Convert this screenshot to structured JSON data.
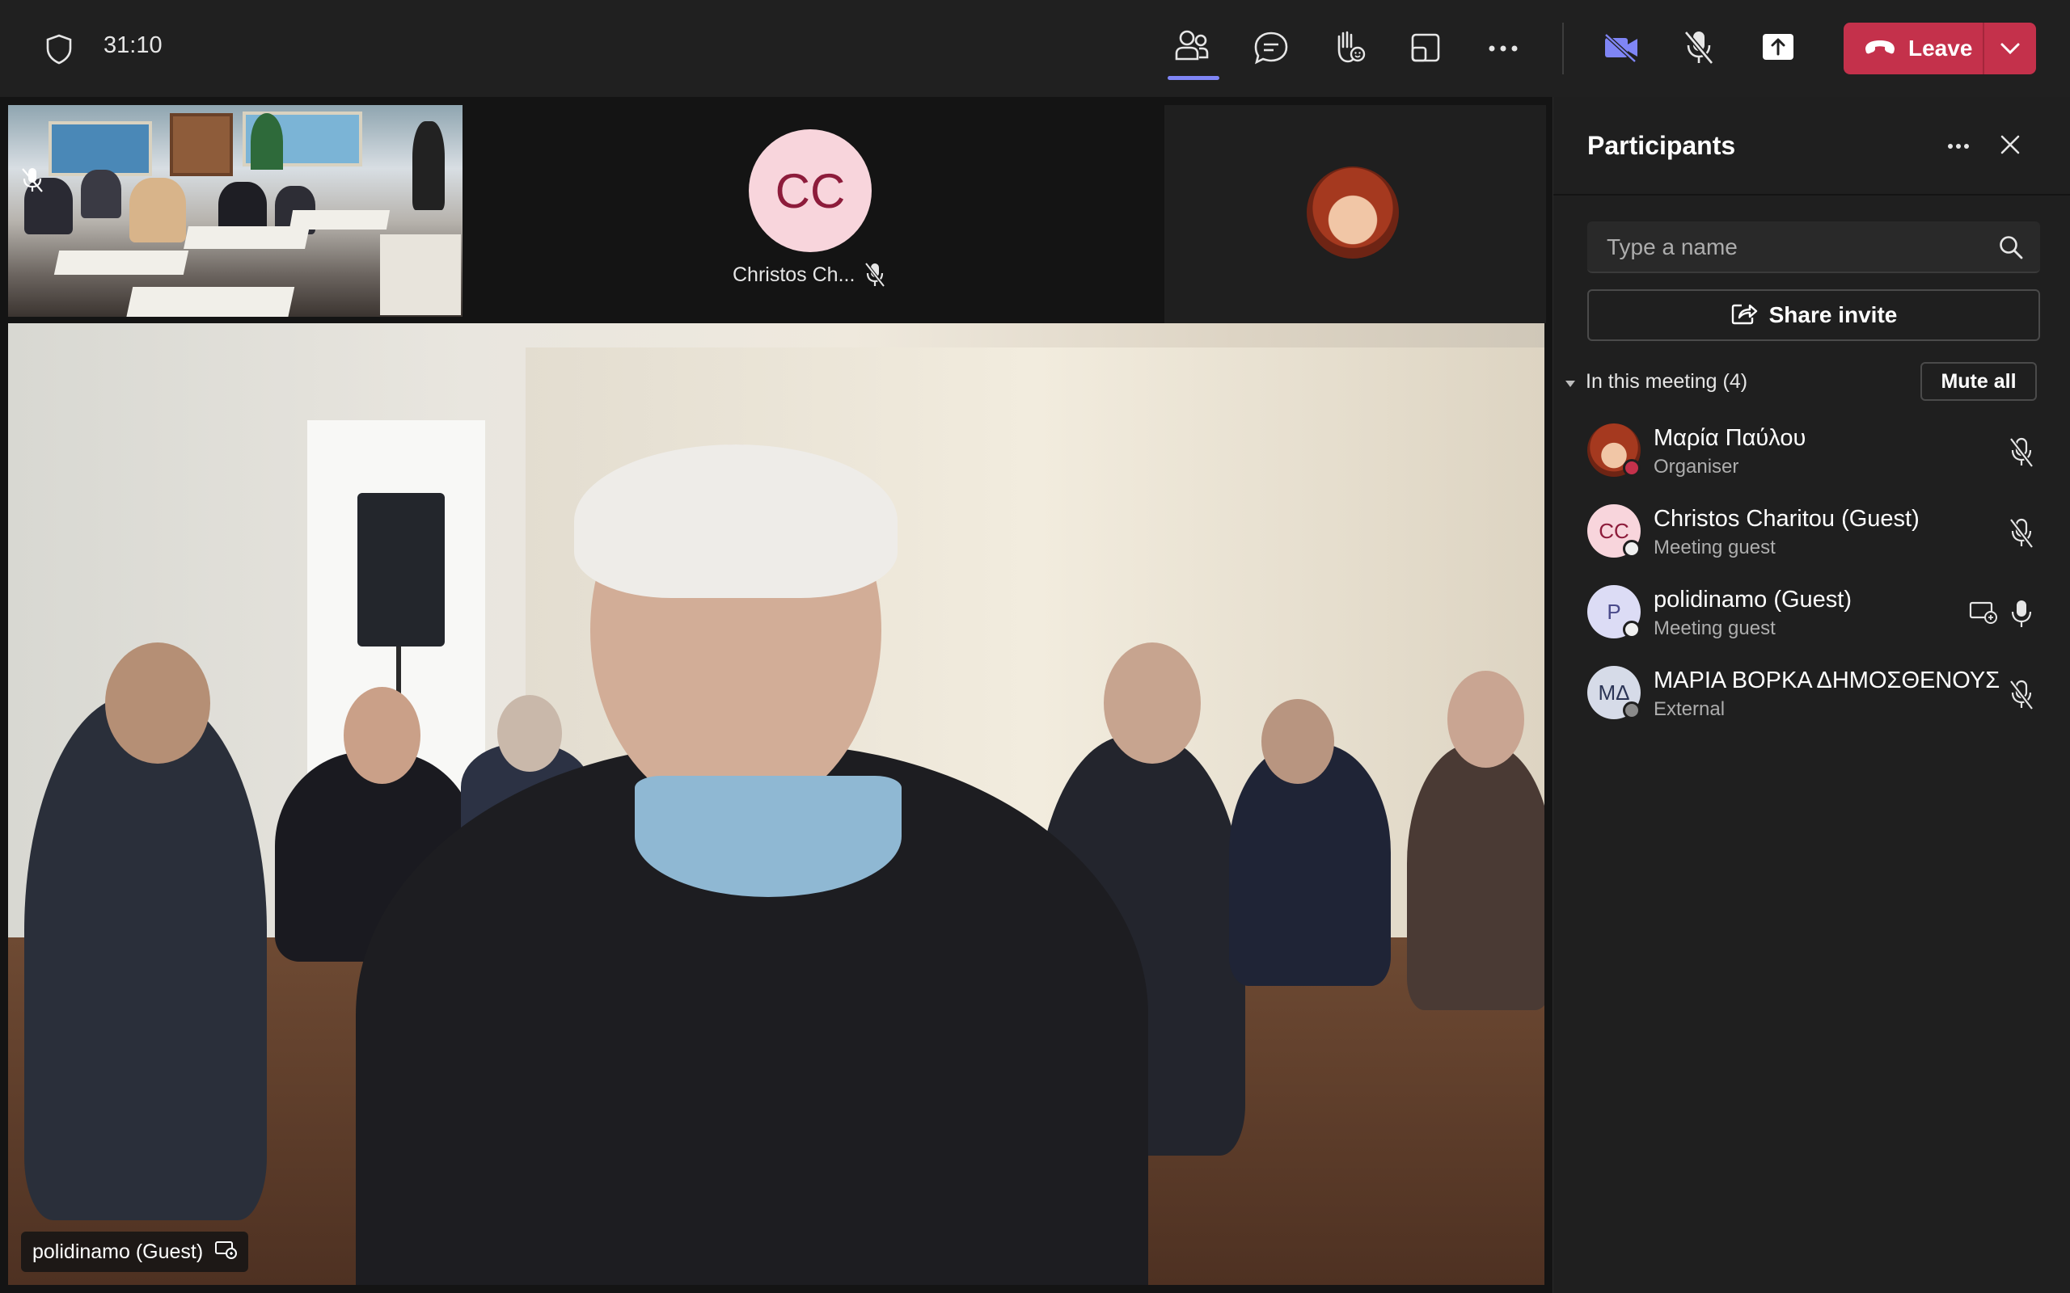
{
  "topbar": {
    "timer": "31:10",
    "leave_label": "Leave",
    "icons": [
      "shield-icon",
      "people-icon",
      "chat-icon",
      "raise-hand-icon",
      "view-icon",
      "more-icon",
      "camera-off-icon",
      "mic-off-icon",
      "share-tray-icon",
      "phone-hangup-icon",
      "chevron-down-icon"
    ]
  },
  "stage": {
    "cc_initials": "CC",
    "cc_name": "Christos Ch...",
    "caption_name": "polidinamo (Guest)"
  },
  "panel": {
    "title": "Participants",
    "search_placeholder": "Type a name",
    "share_invite_label": "Share invite",
    "section_label": "In this meeting (4)",
    "mute_all_label": "Mute all",
    "participants": [
      {
        "initials": "",
        "name": "Μαρία Παύλου",
        "role": "Organiser",
        "status_color": "#c4314b",
        "mic": "muted"
      },
      {
        "initials": "CC",
        "name": "Christos Charitou (Guest)",
        "role": "Meeting guest",
        "status_color": "#f0f0f0",
        "mic": "muted"
      },
      {
        "initials": "P",
        "name": "polidinamo (Guest)",
        "role": "Meeting guest",
        "status_color": "#f0f0f0",
        "mic": "on"
      },
      {
        "initials": "ΜΔ",
        "name": "ΜΑΡΙΑ ΒΟΡΚΑ ΔΗΜΟΣΘΕΝΟΥΣ",
        "role": "External",
        "status_color": "#8a8a8a",
        "mic": "muted"
      }
    ]
  },
  "colors": {
    "accent": "#7f85f5",
    "leave": "#c4314b",
    "cc_avatar_bg": "#f8d5dc",
    "cc_avatar_fg": "#8d1c3b",
    "p_avatar_bg": "#dcdcf5",
    "md_avatar_bg": "#d6dbe8"
  }
}
